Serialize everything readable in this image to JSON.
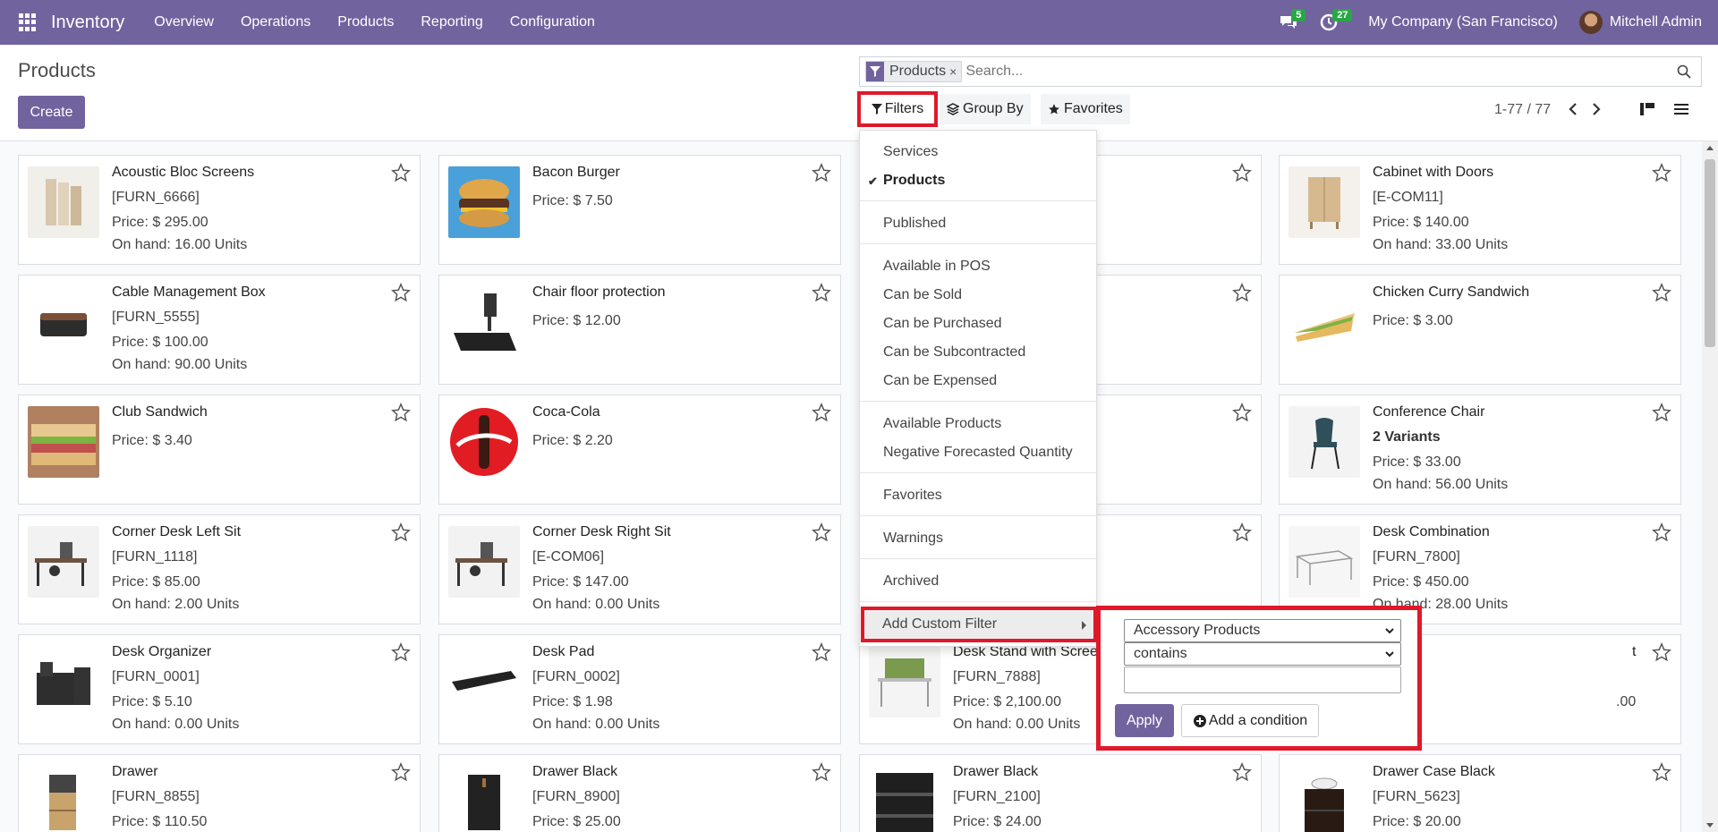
{
  "navbar": {
    "app_name": "Inventory",
    "menu": [
      "Overview",
      "Operations",
      "Products",
      "Reporting",
      "Configuration"
    ],
    "messages_badge": "5",
    "activities_badge": "27",
    "company": "My Company (San Francisco)",
    "user": "Mitchell Admin"
  },
  "control_panel": {
    "title": "Products",
    "create_label": "Create",
    "facet_label": "Products",
    "facet_remove": "×",
    "search_placeholder": "Search...",
    "filters_label": "Filters",
    "groupby_label": "Group By",
    "favorites_label": "Favorites",
    "pager": "1-77 / 77"
  },
  "filter_menu": {
    "items": [
      {
        "label": "Services",
        "checked": false
      },
      {
        "label": "Products",
        "checked": true
      },
      {
        "label": "Published",
        "checked": false
      },
      {
        "label": "Available in POS",
        "checked": false
      },
      {
        "label": "Can be Sold",
        "checked": false
      },
      {
        "label": "Can be Purchased",
        "checked": false
      },
      {
        "label": "Can be Subcontracted",
        "checked": false
      },
      {
        "label": "Can be Expensed",
        "checked": false
      },
      {
        "label": "Available Products",
        "checked": false
      },
      {
        "label": "Negative Forecasted Quantity",
        "checked": false
      },
      {
        "label": "Favorites",
        "checked": false
      },
      {
        "label": "Warnings",
        "checked": false
      },
      {
        "label": "Archived",
        "checked": false
      }
    ],
    "custom_filter_label": "Add Custom Filter"
  },
  "custom_filter": {
    "field": "Accessory Products",
    "operator": "contains",
    "value": "",
    "apply_label": "Apply",
    "add_condition_label": "Add a condition"
  },
  "products": [
    {
      "name": "Acoustic Bloc Screens",
      "ref": "[FURN_6666]",
      "price": "Price: $ 295.00",
      "onhand": "On hand: 16.00 Units"
    },
    {
      "name": "Bacon Burger",
      "price": "Price: $ 7.50"
    },
    {
      "name": "Cabinet with Doors",
      "ref": "[E-COM11]",
      "price": "Price: $ 140.00",
      "onhand": "On hand: 33.00 Units"
    },
    {
      "name": "Cable Management Box",
      "ref": "[FURN_5555]",
      "price": "Price: $ 100.00",
      "onhand": "On hand: 90.00 Units"
    },
    {
      "name": "Chair floor protection",
      "price": "Price: $ 12.00"
    },
    {
      "name": "Chicken Curry Sandwich",
      "price": "Price: $ 3.00"
    },
    {
      "name": "Club Sandwich",
      "price": "Price: $ 3.40"
    },
    {
      "name": "Coca-Cola",
      "price": "Price: $ 2.20"
    },
    {
      "name": "Conference Chair",
      "variants": "2 Variants",
      "price": "Price: $ 33.00",
      "onhand": "On hand: 56.00 Units"
    },
    {
      "name": "Corner Desk Left Sit",
      "ref": "[FURN_1118]",
      "price": "Price: $ 85.00",
      "onhand": "On hand: 2.00 Units"
    },
    {
      "name": "Corner Desk Right Sit",
      "ref": "[E-COM06]",
      "price": "Price: $ 147.00",
      "onhand": "On hand: 0.00 Units"
    },
    {
      "name": "Desk Combination",
      "ref": "[FURN_7800]",
      "price": "Price: $ 450.00",
      "onhand": "On hand: 28.00 Units"
    },
    {
      "name": "Desk Organizer",
      "ref": "[FURN_0001]",
      "price": "Price: $ 5.10",
      "onhand": "On hand: 0.00 Units"
    },
    {
      "name": "Desk Pad",
      "ref": "[FURN_0002]",
      "price": "Price: $ 1.98",
      "onhand": "On hand: 0.00 Units"
    },
    {
      "name": "Desk Stand with Scree",
      "ref": "[FURN_7888]",
      "price": "Price: $ 2,100.00",
      "onhand": "On hand: 0.00 Units"
    },
    {
      "name_fragment": "t",
      "price_fragment": ".00"
    },
    {
      "name": "Drawer",
      "ref": "[FURN_8855]",
      "price": "Price: $ 110.50"
    },
    {
      "name": "Drawer Black",
      "ref": "[FURN_8900]",
      "price": "Price: $ 25.00"
    },
    {
      "name": "Drawer Black",
      "ref": "[FURN_2100]",
      "price": "Price: $ 24.00"
    },
    {
      "name": "Drawer Case Black",
      "ref": "[FURN_5623]",
      "price": "Price: $ 20.00"
    }
  ],
  "colors": {
    "brand": "#71639e",
    "highlight": "#e0192a",
    "badge": "#28a745"
  }
}
